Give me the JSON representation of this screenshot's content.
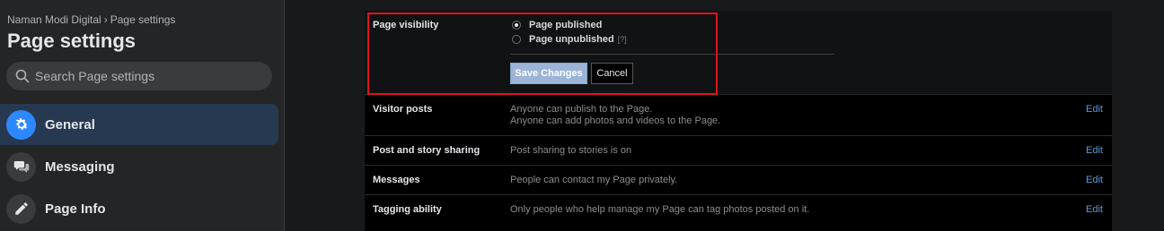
{
  "sidebar": {
    "breadcrumb": {
      "parent": "Naman Modi Digital",
      "separator": "›",
      "current": "Page settings"
    },
    "title": "Page settings",
    "search": {
      "placeholder": "Search Page settings",
      "value": ""
    },
    "items": [
      {
        "label": "General",
        "icon": "gear-icon",
        "active": true
      },
      {
        "label": "Messaging",
        "icon": "chat-bubbles-icon",
        "active": false
      },
      {
        "label": "Page Info",
        "icon": "pencil-icon",
        "active": false
      }
    ]
  },
  "settings": {
    "visibility": {
      "label": "Page visibility",
      "options": [
        {
          "label": "Page published",
          "checked": true
        },
        {
          "label": "Page unpublished",
          "checked": false,
          "help": "[?]"
        }
      ],
      "save_label": "Save Changes",
      "cancel_label": "Cancel"
    },
    "rows": [
      {
        "label": "Visitor posts",
        "lines": [
          "Anyone can publish to the Page.",
          "Anyone can add photos and videos to the Page."
        ],
        "edit": "Edit"
      },
      {
        "label": "Post and story sharing",
        "lines": [
          "Post sharing to stories is on"
        ],
        "edit": "Edit"
      },
      {
        "label": "Messages",
        "lines": [
          "People can contact my Page privately."
        ],
        "edit": "Edit"
      },
      {
        "label": "Tagging ability",
        "lines": [
          "Only people who help manage my Page can tag photos posted on it."
        ],
        "edit": "Edit"
      }
    ]
  },
  "colors": {
    "accent": "#2d88ff",
    "highlight": "#e0141e",
    "link": "#5b9bd5"
  }
}
